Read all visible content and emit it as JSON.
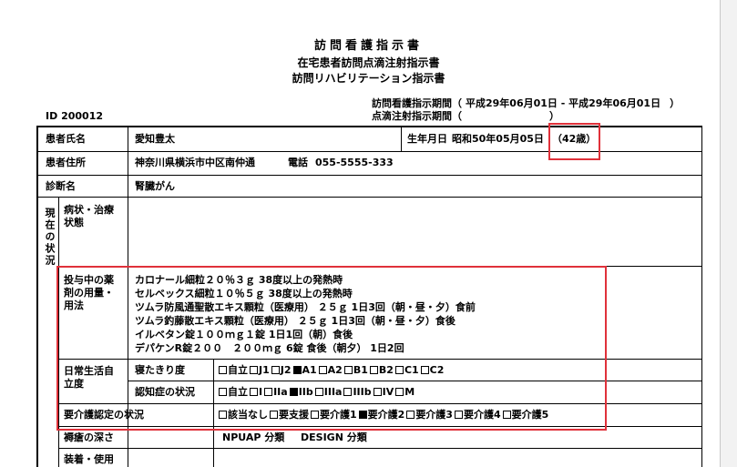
{
  "title": {
    "line1": "訪問看護指示書",
    "line2": "在宅患者訪問点滴注射指示書",
    "line3": "訪問リハビリテーション指示書"
  },
  "header": {
    "id_label": "ID",
    "id_value": "200012",
    "period_label": "訪問看護指示期間（",
    "period_value": "平成29年06月01日 - 平成29年06月01日",
    "period_end": "）",
    "iv_label": "点滴注射指示期間（",
    "iv_end": "）"
  },
  "patient": {
    "name_label": "患者氏名",
    "name": "愛知豊太",
    "dob_label": "生年月日",
    "dob": "昭和50年05月05日",
    "age": "（42歳）",
    "addr_label": "患者住所",
    "address": "神奈川県横浜市中区南仲通",
    "tel_label": "電話",
    "tel": "055-5555-333",
    "diag_label": "診断名",
    "diagnosis": "腎臓がん"
  },
  "status": {
    "section_label": "現在の状況",
    "condition_label": "病状・治療状態",
    "meds_label": "投与中の薬剤の用量・用法",
    "meds": [
      "カロナール細粒２０％３ｇ 38度以上の発熱時",
      "セルベックス細粒１０％５ｇ 38度以上の発熱時",
      "ツムラ防風通聖散エキス顆粒（医療用） ２５ｇ 1日3回（朝・昼・夕）食前",
      "ツムラ釣藤散エキス顆粒（医療用） ２５ｇ 1日3回（朝・昼・夕）食後",
      "イルベタン錠１００ｍｇ１錠 1日1回（朝）食後",
      "デパケンR錠２００　２００ｍｇ 6錠 食後（朝夕） 1日2回"
    ],
    "daily_label": "日常生活自立度",
    "bedridden_label": "寝たきり度",
    "bedridden_options": [
      {
        "label": "自立",
        "checked": false
      },
      {
        "label": "J1",
        "checked": false
      },
      {
        "label": "J2",
        "checked": false
      },
      {
        "label": "A1",
        "checked": true
      },
      {
        "label": "A2",
        "checked": false
      },
      {
        "label": "B1",
        "checked": false
      },
      {
        "label": "B2",
        "checked": false
      },
      {
        "label": "C1",
        "checked": false
      },
      {
        "label": "C2",
        "checked": false
      }
    ],
    "dementia_label": "認知症の状況",
    "dementia_options": [
      {
        "label": "自立",
        "checked": false
      },
      {
        "label": "I",
        "checked": false
      },
      {
        "label": "IIa",
        "checked": false
      },
      {
        "label": "IIb",
        "checked": true
      },
      {
        "label": "IIIa",
        "checked": false
      },
      {
        "label": "IIIb",
        "checked": false
      },
      {
        "label": "IV",
        "checked": false
      },
      {
        "label": "M",
        "checked": false
      }
    ],
    "care_label": "要介護認定の状況",
    "care_options": [
      {
        "label": "該当なし",
        "checked": false
      },
      {
        "label": "要支援",
        "checked": false
      },
      {
        "label": "要介護1",
        "checked": false
      },
      {
        "label": "要介護2",
        "checked": true
      },
      {
        "label": "要介護3",
        "checked": false
      },
      {
        "label": "要介護4",
        "checked": false
      },
      {
        "label": "要介護5",
        "checked": false
      }
    ],
    "ulcer_label": "褥瘡の深さ",
    "npuap_label": "NPUAP 分類",
    "design_label": "DESIGN 分類",
    "device_label": "装着・使用"
  },
  "colors": {
    "highlight": "#e0313a"
  }
}
